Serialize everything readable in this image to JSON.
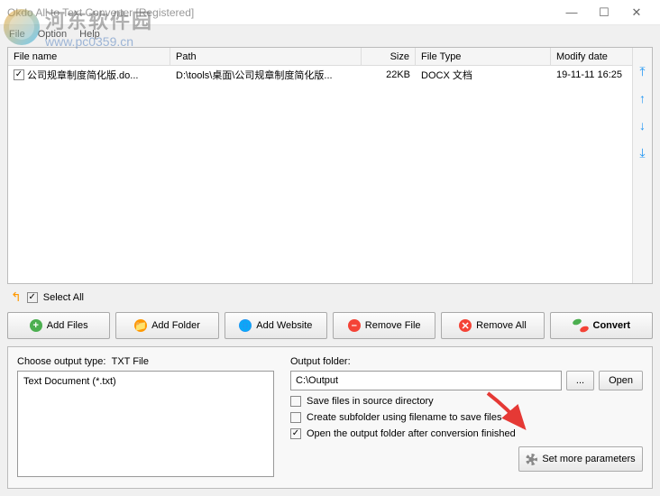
{
  "window": {
    "title": "Okdo All to Text Converter [Registered]",
    "min": "—",
    "max": "☐",
    "close": "✕"
  },
  "watermark": {
    "cn": "河东软件园",
    "url": "www.pc0359.cn"
  },
  "menu": {
    "file": "File",
    "option": "Option",
    "help": "Help"
  },
  "table": {
    "headers": {
      "name": "File name",
      "path": "Path",
      "size": "Size",
      "type": "File Type",
      "date": "Modify date"
    },
    "rows": [
      {
        "name": "公司规章制度简化版.do...",
        "path": "D:\\tools\\桌面\\公司规章制度简化版...",
        "size": "22KB",
        "type": "DOCX 文档",
        "date": "19-11-11 16:25"
      }
    ]
  },
  "selectAll": {
    "label": "Select All"
  },
  "buttons": {
    "addFiles": "Add Files",
    "addFolder": "Add Folder",
    "addWebsite": "Add Website",
    "removeFile": "Remove File",
    "removeAll": "Remove All",
    "convert": "Convert"
  },
  "output": {
    "chooseLabel": "Choose output type:",
    "chooseType": "TXT File",
    "listItem": "Text Document (*.txt)",
    "folderLabel": "Output folder:",
    "folderValue": "C:\\Output",
    "browse": "...",
    "open": "Open",
    "opt1": "Save files in source directory",
    "opt2": "Create subfolder using filename to save files",
    "opt3": "Open the output folder after conversion finished",
    "setMore": "Set more parameters"
  }
}
